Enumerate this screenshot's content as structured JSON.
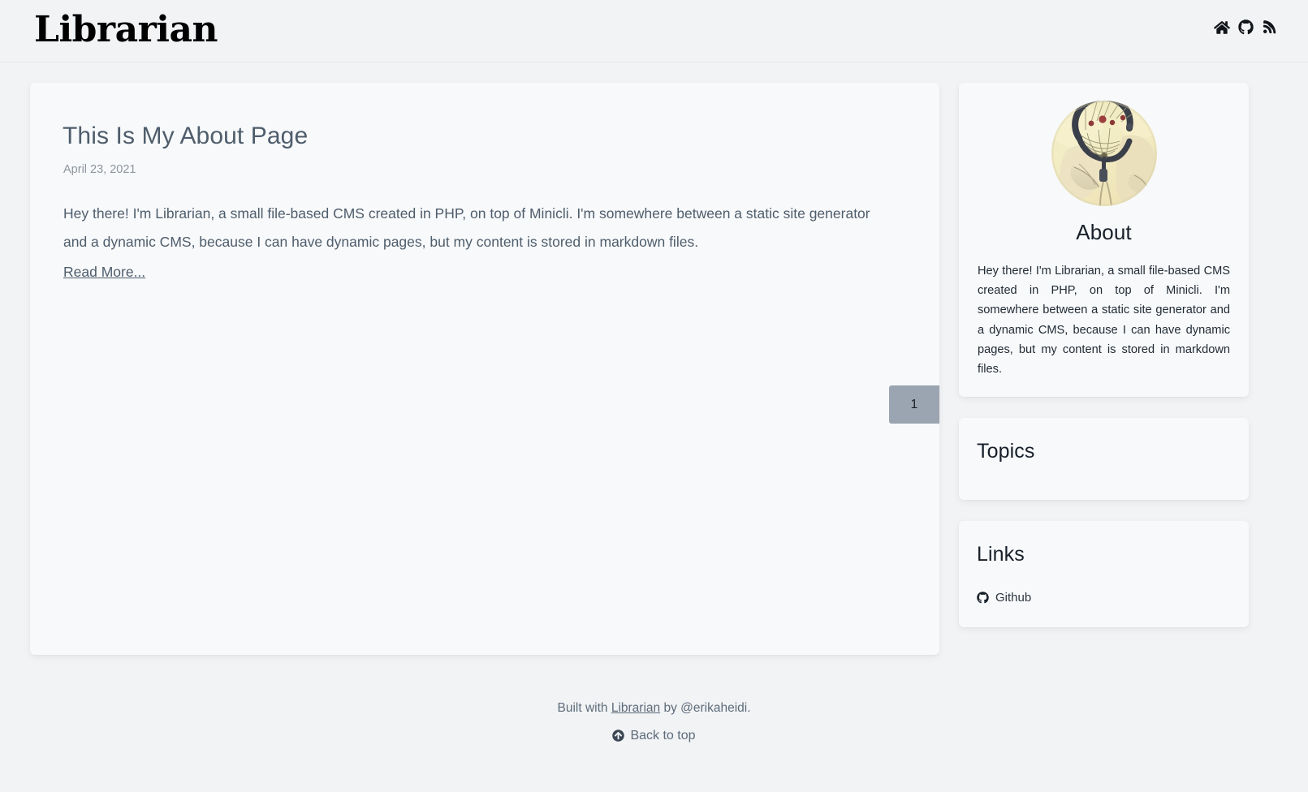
{
  "header": {
    "brand": "Librarian",
    "icons": [
      {
        "name": "home-icon",
        "label": "Home"
      },
      {
        "name": "github-icon",
        "label": "Github"
      },
      {
        "name": "rss-icon",
        "label": "RSS Feed"
      }
    ]
  },
  "post": {
    "title": "This Is My About Page",
    "date": "April 23, 2021",
    "excerpt": "Hey there! I'm Librarian, a small file-based CMS created in PHP, on top of Minicli. I'm somewhere between a static site generator and a dynamic CMS, because I can have dynamic pages, but my content is stored in markdown files.",
    "read_more": "Read More..."
  },
  "pagination": {
    "pages": [
      "1"
    ],
    "current": "1",
    "active_bg": "#9ba4b1"
  },
  "sidebar": {
    "about": {
      "avatar_alt": "dreamcatcher-photo",
      "title": "About",
      "text": "Hey there! I'm Librarian, a small file-based CMS created in PHP, on top of Minicli. I'm somewhere between a static site generator and a dynamic CMS, because I can have dynamic pages, but my content is stored in markdown files."
    },
    "topics": {
      "title": "Topics",
      "items": []
    },
    "links": {
      "title": "Links",
      "items": [
        {
          "label": "Github",
          "icon": "github-icon"
        }
      ]
    }
  },
  "footer": {
    "built_with_prefix": "Built with ",
    "built_with_link": "Librarian",
    "built_with_suffix": " by @erikaheidi.",
    "back_to_top": "Back to top"
  }
}
